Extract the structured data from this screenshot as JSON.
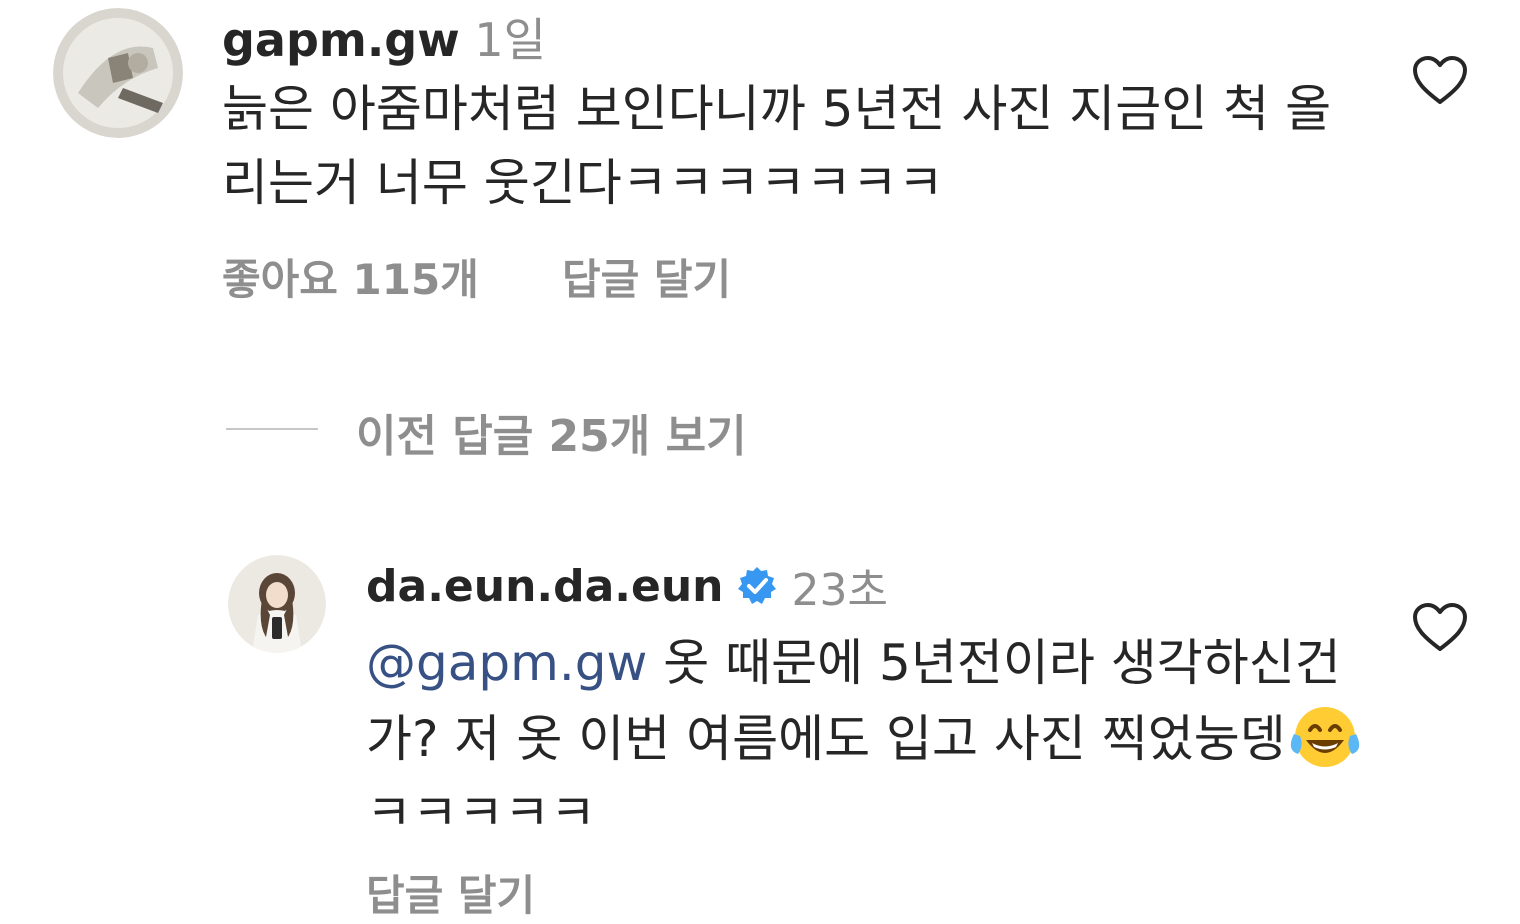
{
  "comments": [
    {
      "username": "gapm.gw",
      "time": "1일",
      "text": "늙은 아줌마처럼 보인다니까 5년전 사진 지금인 척 올리는거 너무 웃긴다ㅋㅋㅋㅋㅋㅋㅋ",
      "likes": "좋아요 115개",
      "reply_label": "답글 달기",
      "avatar_icon": "avatar-photo",
      "heart_icon": "heart-outline-icon"
    },
    {
      "username": "da.eun.da.eun",
      "verified": true,
      "time": "23초",
      "mention": "@gapm.gw",
      "text_before_emoji": " 옷 때문에 5년전이라 생각하신건가? 저 옷 이번 여름에도 입고 사진 찍었눙뎅",
      "emoji_icon": "face-with-tears-of-joy",
      "text_after_emoji": " ㅋㅋㅋㅋㅋ",
      "reply_label": "답글 달기",
      "avatar_icon": "avatar-photo",
      "heart_icon": "heart-outline-icon"
    }
  ],
  "view_replies_label": "이전 답글 25개 보기",
  "colors": {
    "text": "#262626",
    "secondary": "#8e8e8e",
    "mention": "#385185",
    "verified": "#3897f0"
  }
}
